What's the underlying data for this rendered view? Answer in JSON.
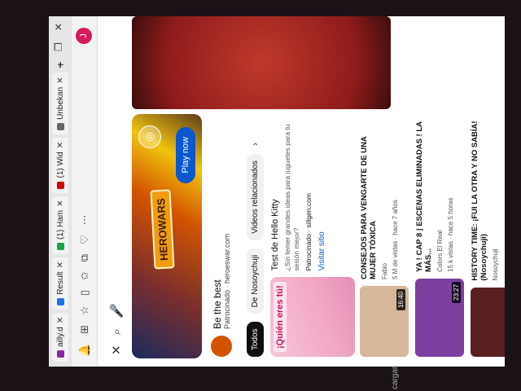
{
  "browser": {
    "tabs": [
      {
        "label": "ailly.d",
        "color": "#8e24aa"
      },
      {
        "label": "Result",
        "color": "#1a73e8"
      },
      {
        "label": "(1) Ham",
        "color": "#16a34a"
      },
      {
        "label": "(1) Wid",
        "color": "#cc0000"
      },
      {
        "label": "Unbekan",
        "color": "#666666"
      }
    ],
    "avatar_letter": "J"
  },
  "ad": {
    "game_logo": "HEROWARS",
    "title": "Be the best",
    "sponsor": "Patrocinado · heroeswar.com",
    "cta": "Play now"
  },
  "chips": [
    {
      "label": "Todos",
      "active": true
    },
    {
      "label": "De Nosoychuji",
      "active": false
    },
    {
      "label": "Videos relacionados",
      "active": false
    }
  ],
  "featured": {
    "thumb_text": "¡Quién eres tú!",
    "title": "Test de Hello Kitty",
    "desc": "¿Sin temer grandes ideas para juguetes para tu sesión mejor?",
    "sponsored": "Patrocinado · sillgen.com",
    "visit": "Visitar sitio"
  },
  "videos": [
    {
      "title": "CONSEJOS PARA VENGARTE DE UNA MUJER TÓXICA",
      "channel": "Fabio",
      "meta": "5 M de vistas · hace 7 años",
      "duration": "16:40",
      "thumb": "#d6b79a"
    },
    {
      "title": "YA ! CAP 8 | ESCENAS ELIMINADAS ! LA MÁS...",
      "channel": "Colors El Real",
      "meta": "15 k vistas · hace 5 horas",
      "duration": "23:27",
      "thumb": "#7b3fa1"
    },
    {
      "title": "HISTORY TIME: ¡FUI LA OTRA Y NO SABÍA! (Nosoychuji)",
      "channel": "Nosoychuji",
      "meta": "",
      "duration": "",
      "thumb": "#5a1f1f"
    }
  ],
  "bottom": "cargar"
}
